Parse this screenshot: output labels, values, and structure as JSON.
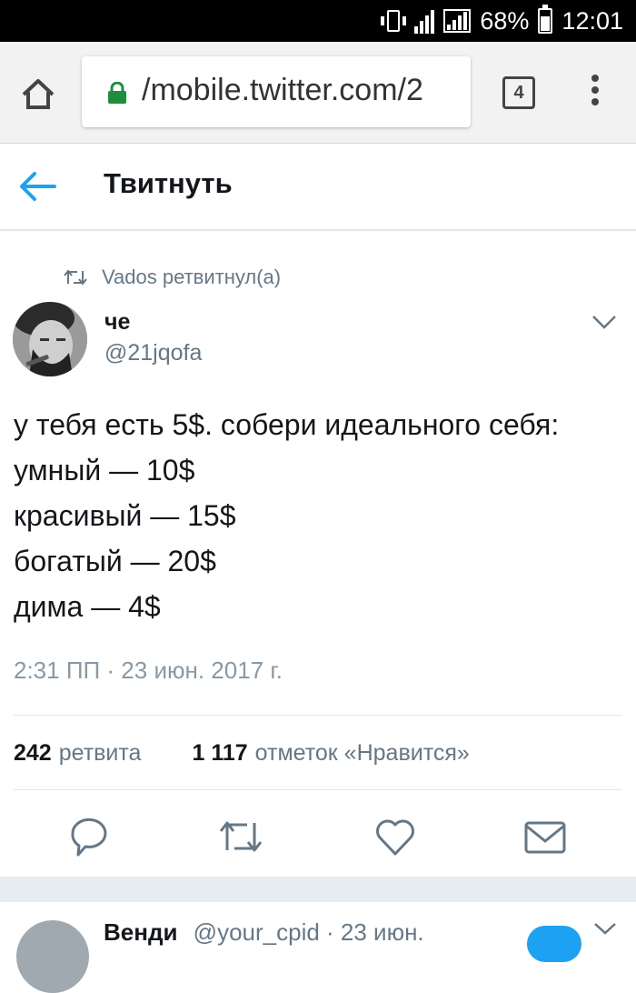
{
  "status_bar": {
    "battery_percent": "68%",
    "time": "12:01",
    "battery_level": 0.68
  },
  "browser": {
    "url_display": "/mobile.twitter.com/2",
    "tab_count": "4"
  },
  "header": {
    "title": "Твитнуть"
  },
  "tweet": {
    "retweet_label": "Vados ретвитнул(а)",
    "author_name": "че",
    "author_handle": "@21jqofa",
    "lines": [
      "у тебя есть 5$. собери идеального себя:",
      "умный — 10$",
      "красивый — 15$",
      "богатый — 20$",
      "дима — 4$"
    ],
    "timestamp": "2:31 ПП · 23 июн. 2017 г.",
    "retweets_count": "242",
    "retweets_label": "ретвита",
    "likes_count": "1 117",
    "likes_label": "отметок «Нравится»"
  },
  "next_tweet": {
    "author_name": "Венди",
    "meta": "@your_cpid · 23 июн."
  },
  "colors": {
    "accent": "#1da1f2",
    "secure": "#1e8e3e",
    "muted": "#657786"
  }
}
